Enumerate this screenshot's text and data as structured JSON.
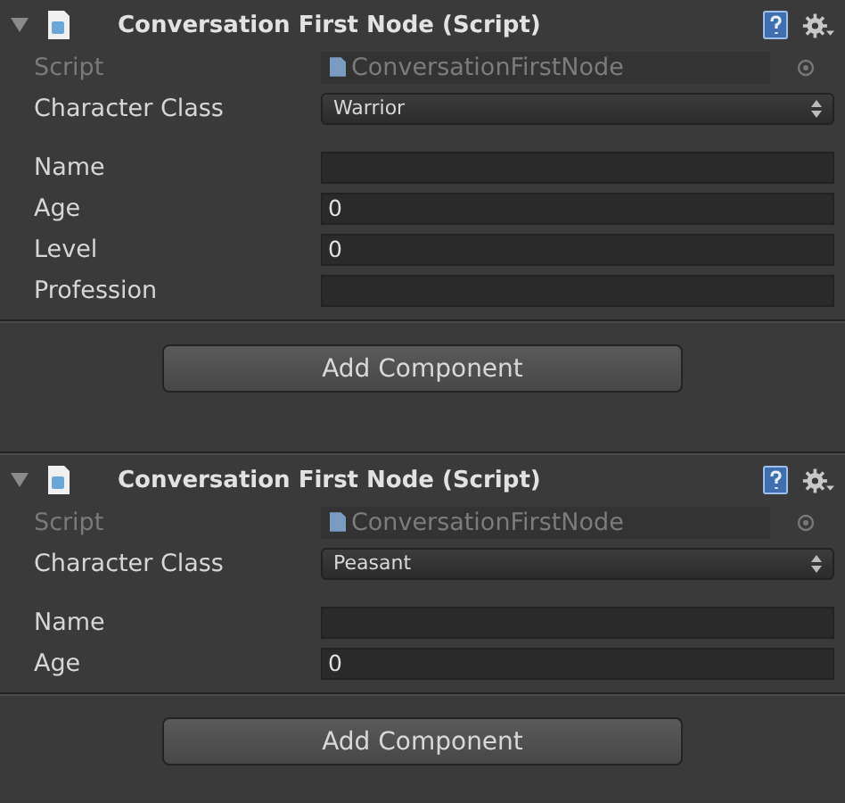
{
  "components": [
    {
      "title": "Conversation First Node (Script)",
      "expanded": true,
      "script_label": "Script",
      "script_value": "ConversationFirstNode",
      "fields": [
        {
          "kind": "dropdown",
          "label": "Character Class",
          "value": "Warrior"
        },
        {
          "kind": "text",
          "label": "Name"
        },
        {
          "kind": "text",
          "label": "Age",
          "value": "0"
        },
        {
          "kind": "text",
          "label": "Level",
          "value": "0"
        },
        {
          "kind": "text",
          "label": "Profession"
        }
      ],
      "button": "Add Component"
    },
    {
      "title": "Conversation First Node (Script)",
      "expanded": true,
      "script_label": "Script",
      "script_value": "ConversationFirstNode",
      "fields": [
        {
          "kind": "dropdown",
          "label": "Character Class",
          "value": "Peasant"
        },
        {
          "kind": "text",
          "label": "Name"
        },
        {
          "kind": "text",
          "label": "Age",
          "value": "0"
        }
      ],
      "button": "Add Component"
    }
  ]
}
